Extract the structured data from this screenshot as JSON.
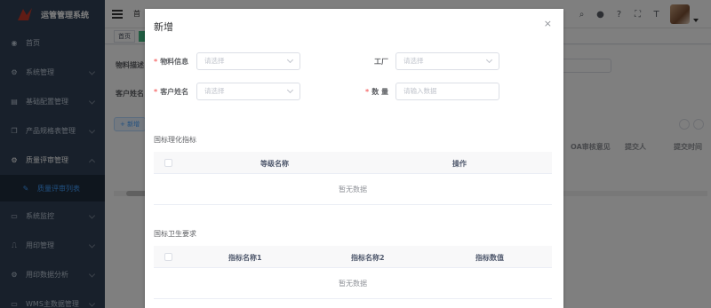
{
  "app": {
    "title": "运管管理系统"
  },
  "sidebar": {
    "items": [
      {
        "label": "首页",
        "icon": "dashboard-icon"
      },
      {
        "label": "系统管理",
        "icon": "gear-icon"
      },
      {
        "label": "基础配置管理",
        "icon": "document-icon"
      },
      {
        "label": "产品规格表管理",
        "icon": "copy-icon"
      },
      {
        "label": "质量评审管理",
        "icon": "gear-icon"
      },
      {
        "label": "质量评审列表",
        "icon": "edit-icon"
      },
      {
        "label": "系统监控",
        "icon": "monitor-icon"
      },
      {
        "label": "用印管理",
        "icon": "stamp-icon"
      },
      {
        "label": "用印数据分析",
        "icon": "gear-icon"
      },
      {
        "label": "WMS主数据管理",
        "icon": "monitor-icon"
      }
    ]
  },
  "navbar": {
    "breadcrumb": "首"
  },
  "tags": {
    "home": "首页"
  },
  "background": {
    "label_material": "物料描述",
    "label_customer": "客户姓名",
    "add_button": "+ 新增",
    "col_oa": "OA审核意见",
    "col_submitter": "提交人",
    "col_time": "提交时间"
  },
  "dialog": {
    "title": "新增",
    "close": "×",
    "fields": {
      "material": {
        "label": "物料信息",
        "placeholder": "请选择"
      },
      "factory": {
        "label": "工厂",
        "placeholder": "请选择"
      },
      "customer": {
        "label": "客户姓名",
        "placeholder": "请选择"
      },
      "quantity": {
        "label": "数 量",
        "placeholder": "请输入数据"
      }
    },
    "section1": {
      "title": "国标理化指标",
      "columns": [
        "等级名称",
        "操作"
      ],
      "empty": "暂无数据"
    },
    "section2": {
      "title": "国标卫生要求",
      "columns": [
        "指标名称1",
        "指标名称2",
        "指标数值"
      ],
      "empty": "暂无数据"
    }
  }
}
